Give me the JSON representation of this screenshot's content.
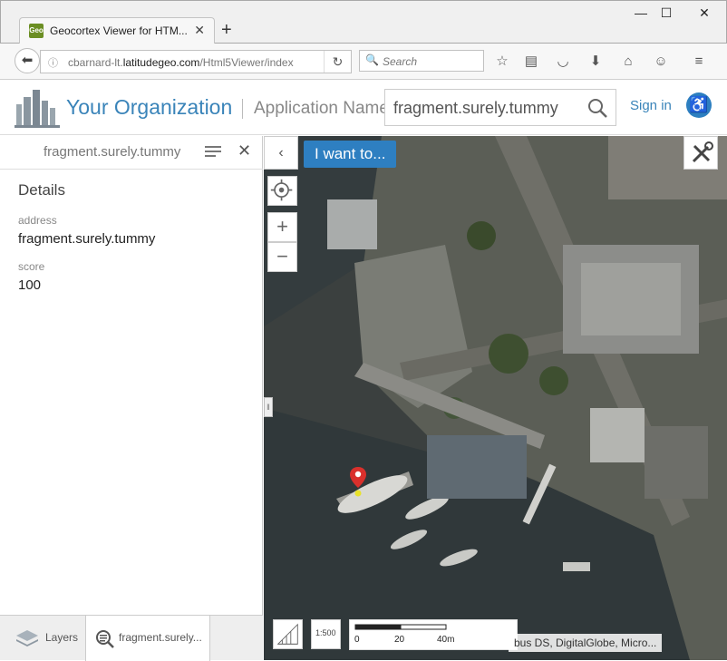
{
  "browser": {
    "tab_title": "Geocortex Viewer for HTM...",
    "favicon_text": "Geo",
    "url_prefix": "cbarnard-lt.",
    "url_domain": "latitudegeo.com",
    "url_path": "/Html5Viewer/index",
    "search_placeholder": "Search"
  },
  "header": {
    "org_name": "Your Organization",
    "app_name": "Application Name",
    "search_value": "fragment.surely.tummy",
    "sign_in": "Sign in"
  },
  "panel": {
    "title": "fragment.surely.tummy",
    "details_title": "Details",
    "attributes": [
      {
        "label": "address",
        "value": "fragment.surely.tummy"
      },
      {
        "label": "score",
        "value": "100"
      }
    ],
    "tabs": {
      "layers": "Layers",
      "results": "fragment.surely..."
    }
  },
  "map": {
    "i_want_to": "I want to...",
    "scale_labels": [
      "0",
      "20",
      "40m"
    ],
    "scale_ratio": "1:500",
    "attribution": "bus DS, DigitalGlobe, Micro..."
  },
  "colors": {
    "accent": "#2e7fc1",
    "org_text": "#3a84b9",
    "pin": "#d9302c"
  }
}
